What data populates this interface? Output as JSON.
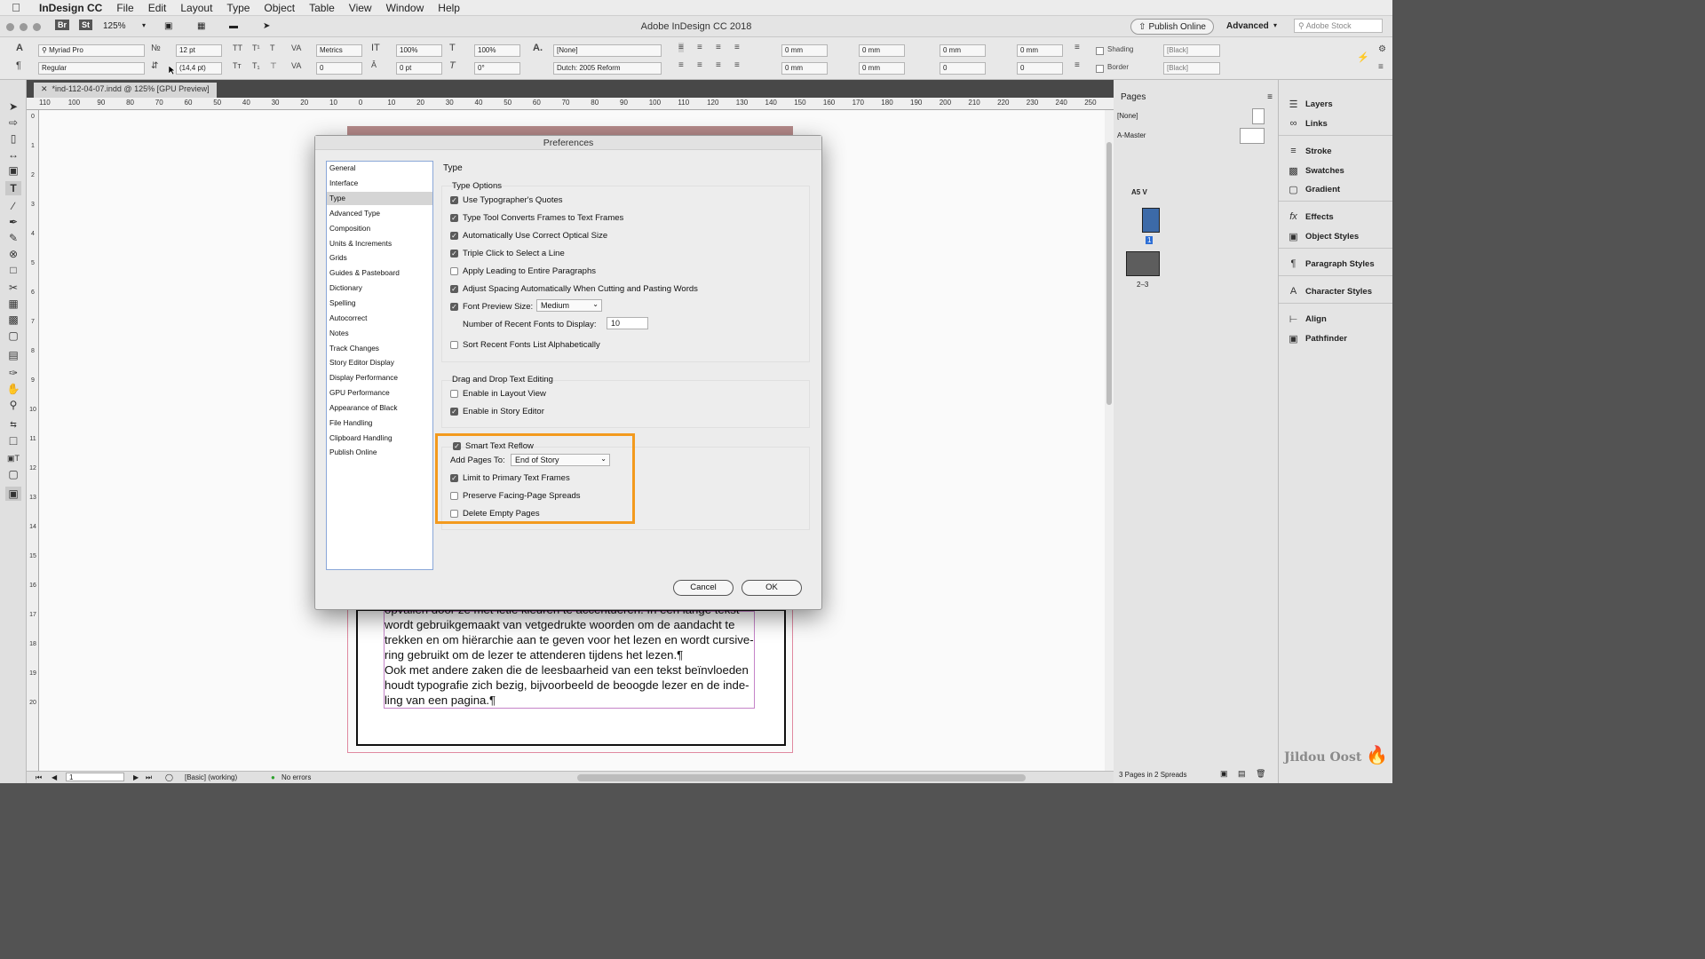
{
  "menubar": {
    "app": "InDesign CC",
    "items": [
      "File",
      "Edit",
      "Layout",
      "Type",
      "Object",
      "Table",
      "View",
      "Window",
      "Help"
    ]
  },
  "window": {
    "title": "Adobe InDesign CC 2018",
    "zoom": "125%",
    "publish_label": "Publish Online",
    "workspace": "Advanced",
    "stock_placeholder": "Adobe Stock",
    "br": "Br",
    "st": "St"
  },
  "control": {
    "font_family": "Myriad Pro",
    "font_style": "Regular",
    "font_size": "12 pt",
    "leading": "(14,4 pt)",
    "kerning": "Metrics",
    "tracking": "0",
    "vscale": "100%",
    "hscale": "100%",
    "baseline": "0 pt",
    "skew": "0°",
    "char_style": "[None]",
    "language": "Dutch: 2005 Reform",
    "indent_left": "0 mm",
    "indent_right": "0 mm",
    "indent_first": "0 mm",
    "indent_last": "0 mm",
    "space_before": "0 mm",
    "space_after": "0 mm",
    "drop_lines": "0",
    "drop_chars": "0",
    "shading": "Shading",
    "border": "Border",
    "swatch1": "[Black]",
    "swatch2": "[Black]"
  },
  "doc_tab": "*ind-112-04-07.indd @ 125% [GPU Preview]",
  "ruler_h": [
    "110",
    "100",
    "90",
    "80",
    "70",
    "60",
    "50",
    "40",
    "30",
    "20",
    "10",
    "0",
    "10",
    "20",
    "30",
    "40",
    "50",
    "60",
    "70",
    "80",
    "90",
    "100",
    "110",
    "120",
    "130",
    "140",
    "150",
    "160",
    "170",
    "180",
    "190",
    "200",
    "210",
    "220",
    "230",
    "240",
    "250"
  ],
  "ruler_v": [
    "0",
    "1",
    "2",
    "3",
    "4",
    "5",
    "6",
    "7",
    "8",
    "9",
    "10",
    "11",
    "12",
    "13",
    "14",
    "15",
    "16",
    "17",
    "18",
    "19",
    "20"
  ],
  "body_text": [
    "opvallen door ze met ietie kleuren te accentueren. In een lange tekst",
    "wordt gebruikgemaakt van vetgedrukte woorden om de aandacht te",
    "trekken en om hiërarchie aan te geven voor het lezen en wordt cursive-",
    "ring gebruikt om de lezer te attenderen tijdens het lezen.¶",
    "Ook met andere zaken die de leesbaarheid van een tekst beïnvloeden",
    "houdt typografie zich bezig, bijvoorbeeld de beoogde lezer en de inde-",
    "ling van een pagina.¶"
  ],
  "status": {
    "page": "1",
    "preflight_profile": "[Basic] (working)",
    "errors": "No errors"
  },
  "pages_panel": {
    "title": "Pages",
    "none_label": "[None]",
    "master_label": "A-Master",
    "master_select": "A5 V",
    "page1": "1",
    "spread_label": "2–3",
    "footer": "3 Pages in 2 Spreads"
  },
  "panels": [
    "Layers",
    "Links",
    "Stroke",
    "Swatches",
    "Gradient",
    "Effects",
    "Object Styles",
    "Paragraph Styles",
    "Character Styles",
    "Align",
    "Pathfinder"
  ],
  "watermark": "Jildou Oost",
  "dialog": {
    "title": "Preferences",
    "categories": [
      "General",
      "Interface",
      "Type",
      "Advanced Type",
      "Composition",
      "Units & Increments",
      "Grids",
      "Guides & Pasteboard",
      "Dictionary",
      "Spelling",
      "Autocorrect",
      "Notes",
      "Track Changes",
      "Story Editor Display",
      "Display Performance",
      "GPU Performance",
      "Appearance of Black",
      "File Handling",
      "Clipboard Handling",
      "Publish Online"
    ],
    "selected_category": "Type",
    "section_title": "Type",
    "type_options": {
      "label": "Type Options",
      "use_quotes": "Use Typographer's Quotes",
      "convert_frames": "Type Tool Converts Frames to Text Frames",
      "optical_size": "Automatically Use Correct Optical Size",
      "triple_click": "Triple Click to Select a Line",
      "apply_leading": "Apply Leading to Entire Paragraphs",
      "adjust_spacing": "Adjust Spacing Automatically When Cutting and Pasting Words",
      "font_preview": "Font Preview Size:",
      "font_preview_value": "Medium",
      "recent_fonts": "Number of Recent Fonts to Display:",
      "recent_fonts_value": "10",
      "sort_recent": "Sort Recent Fonts List Alphabetically"
    },
    "drag_drop": {
      "label": "Drag and Drop Text Editing",
      "layout_view": "Enable in Layout View",
      "story_editor": "Enable in Story Editor"
    },
    "reflow": {
      "smart_reflow": "Smart Text Reflow",
      "add_pages": "Add Pages To:",
      "add_pages_value": "End of Story",
      "limit_primary": "Limit to Primary Text Frames",
      "preserve_spreads": "Preserve Facing-Page Spreads",
      "delete_empty": "Delete Empty Pages"
    },
    "cancel": "Cancel",
    "ok": "OK"
  },
  "colors": {
    "highlight": "#f39a1e",
    "bleed": "#e089a0",
    "frame": "#c583c8"
  }
}
